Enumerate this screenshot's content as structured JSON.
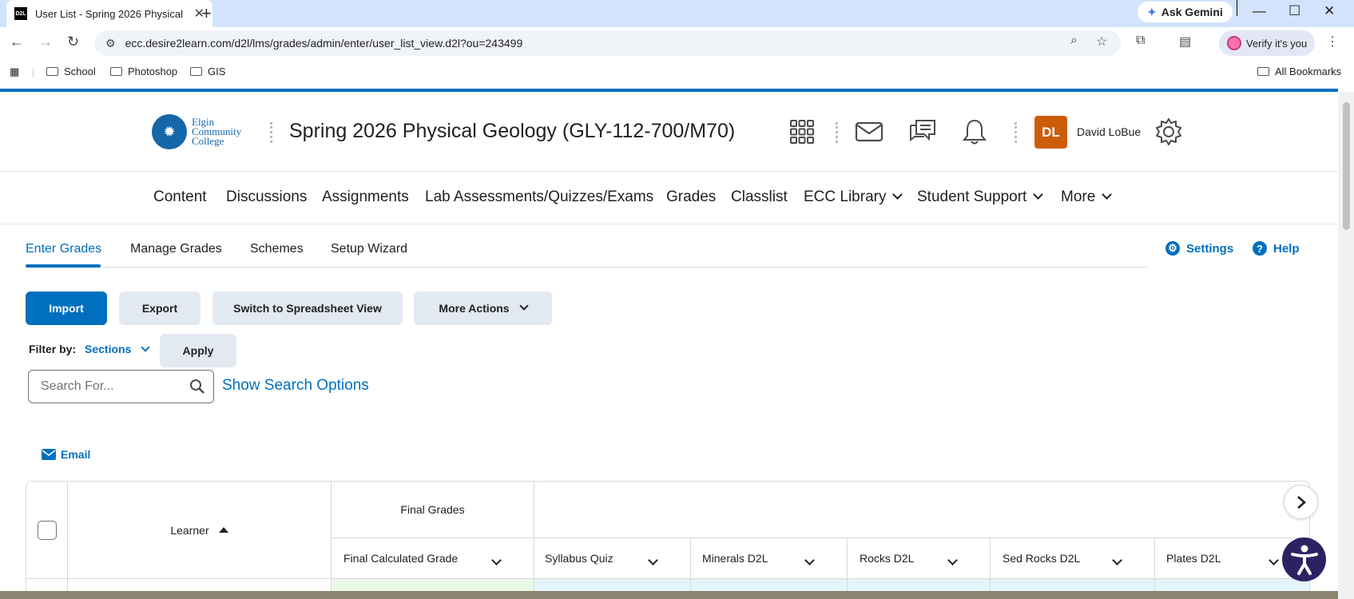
{
  "browser": {
    "tab_title": "User List - Spring 2026 Physical",
    "favicon_text": "D2L",
    "close_glyph": "✕",
    "new_tab_glyph": "+",
    "ask_gemini": "Ask Gemini",
    "url": "ecc.desire2learn.com/d2l/lms/grades/admin/enter/user_list_view.d2l?ou=243499",
    "verify_label": "Verify it's you",
    "bookmarks": [
      "School",
      "Photoshop",
      "GIS"
    ],
    "all_bookmarks": "All Bookmarks"
  },
  "header": {
    "logo_line1": "Elgin",
    "logo_line2": "Community",
    "logo_line3": "College",
    "course_title": "Spring 2026 Physical Geology (GLY-112-700/M70)",
    "avatar_initials": "DL",
    "user_name": "David LoBue",
    "avatar_color": "#cd5c0a"
  },
  "nav": {
    "items": [
      "Content",
      "Discussions",
      "Assignments",
      "Lab Assessments/Quizzes/Exams",
      "Grades",
      "Classlist",
      "ECC Library",
      "Student Support",
      "More"
    ]
  },
  "subnav": {
    "tabs": [
      "Enter Grades",
      "Manage Grades",
      "Schemes",
      "Setup Wizard"
    ],
    "settings": "Settings",
    "help": "Help",
    "help_glyph": "?"
  },
  "actions": {
    "import": "Import",
    "export": "Export",
    "spreadsheet": "Switch to Spreadsheet View",
    "more_actions": "More Actions",
    "filter_by": "Filter by:",
    "sections": "Sections",
    "apply": "Apply"
  },
  "search": {
    "placeholder": "Search For...",
    "show_options": "Show Search Options"
  },
  "email_label": "Email",
  "table": {
    "learner_header": "Learner",
    "final_grades_group": "Final Grades",
    "columns": [
      "Final Calculated Grade",
      "Syllabus Quiz",
      "Minerals D2L",
      "Rocks D2L",
      "Sed Rocks D2L",
      "Plates D2L"
    ]
  },
  "colors": {
    "accent": "#006fbf",
    "final_grade_cell": "#eaf8e8",
    "grade_cell": "#e3f5fb"
  }
}
